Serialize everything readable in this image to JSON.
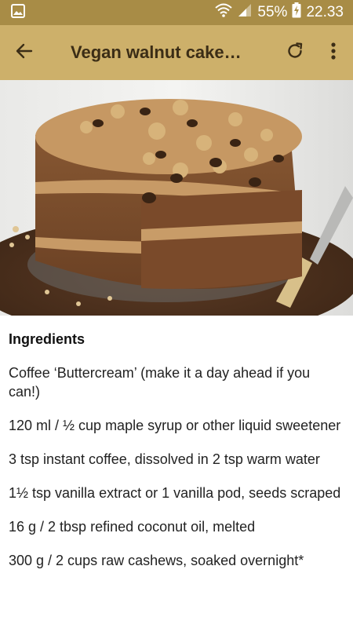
{
  "status_bar": {
    "battery": "55%",
    "time": "22.33",
    "icons": [
      "image-icon",
      "wifi-icon",
      "signal-icon",
      "battery-charging-icon"
    ]
  },
  "app_bar": {
    "title": "Vegan walnut cake…",
    "back_icon": "arrow-back-icon",
    "refresh_icon": "refresh-icon",
    "menu_icon": "more-vert-icon",
    "background": "#cdb06a",
    "status_background": "#a88c46"
  },
  "content": {
    "heading": "Ingredients",
    "ingredients": [
      "Coffee ‘Buttercream’ (make it a day ahead if you can!)",
      "120 ml / ½ cup maple syrup or other liquid sweetener",
      "3 tsp instant coffee, dissolved in 2 tsp warm water",
      "1½ tsp vanilla extract or 1 vanilla pod, seeds scraped",
      "16 g / 2 tbsp refined coconut oil, melted",
      "300 g / 2 cups raw cashews, soaked overnight*"
    ]
  }
}
